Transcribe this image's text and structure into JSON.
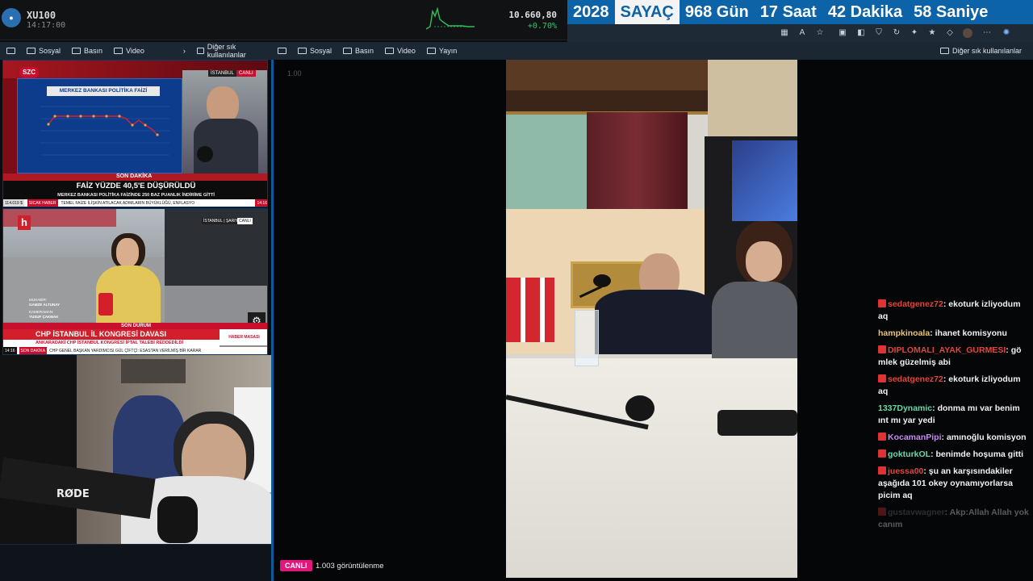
{
  "ticker": {
    "symbol": "XU100",
    "time": "14:17:00",
    "value": "10.660,80",
    "change": "+0.70%"
  },
  "countdown": {
    "year": "2028",
    "label": "SAYAÇ",
    "days": "968 Gün",
    "hours": "17 Saat",
    "minutes": "42 Dakika",
    "seconds": "58 Saniye"
  },
  "bookmarks_left": [
    "Sosyal",
    "Basın",
    "Video"
  ],
  "bookmarks_left_other": "Diğer sık kullanılanlar",
  "bookmarks_right": [
    "Sosyal",
    "Basın",
    "Video",
    "Yayın"
  ],
  "bookmarks_right_other": "Diğer sık kullanılanlar",
  "tv1": {
    "channel": "SZC",
    "chart_title": "MERKEZ BANKASI POLİTİKA FAİZİ",
    "location": "İSTANBUL",
    "live": "CANLI",
    "breaking": "SON DAKİKA",
    "headline": "FAİZ YÜZDE 40,5'E DÜŞÜRÜLDÜ",
    "subline": "MERKEZ BANKASI POLİTİKA FAİZİNDE 250 BAZ PUANLIK İNDİRİME GİTTİ",
    "ticker_a": "114.019 $",
    "ticker_b": "SICAK HABER",
    "ticker_c": "TEMEL FAİZE İLİŞKİN ATILACAK ADIMLARIN BÜYÜKLÜĞÜ, ENFLASYO",
    "ticker_time": "14:16"
  },
  "tv2": {
    "channel": "h",
    "location": "İSTANBUL | ŞARIYER",
    "live": "CANLI",
    "reporter_label": "MUHABİR:",
    "reporter": "GAMZE ALTUNAY",
    "camera_label": "KAMERAMAN:",
    "camera": "YUSUF ÇAKMAK",
    "banner": "SON DURUM",
    "headline": "CHP İSTANBUL İL KONGRESİ DAVASI",
    "subline": "ANKARADAKİ CHP İSTANBUL KONGRESİ İPTAL TALEBİ REDDEDİLDİ",
    "tag": "HABER MASASI",
    "ticker_time": "14:16",
    "ticker_label": "SON DAKİKA",
    "ticker_text": "CHP GENEL BAŞKAN YARDIMCISI GÜL ÇİFTÇİ: ESASTAN VERİLMİŞ BİR KARAR"
  },
  "cam": {
    "mic_brand": "RØDE"
  },
  "player": {
    "speed": "1.00",
    "live": "CANLI",
    "views": "1.003 görüntülenme"
  },
  "chat": [
    {
      "user": "sedatgenez72",
      "color": "#e0463c",
      "text": "ekoturk izliyodum aq",
      "badge": true
    },
    {
      "user": "hampkinoala",
      "color": "#e8c37a",
      "text": "ihanet komisyonu",
      "badge": false
    },
    {
      "user": "DIPLOMALI_AYAK_GURMESI",
      "color": "#e0463c",
      "text": "gö mlek güzelmiş abi",
      "badge": true
    },
    {
      "user": "sedatgenez72",
      "color": "#e0463c",
      "text": "ekoturk izliyodum aq",
      "badge": true
    },
    {
      "user": "1337Dynamic",
      "color": "#68d9a8",
      "text": "donma mı var benim ınt mı yar yedi",
      "badge": false
    },
    {
      "user": "KocamanPipi",
      "color": "#c48cf0",
      "text": "amınoğlu komisyon",
      "badge": true
    },
    {
      "user": "gokturkOL",
      "color": "#68d9a8",
      "text": "benimde hoşuma gitti",
      "badge": true
    },
    {
      "user": "juessa00",
      "color": "#e0463c",
      "text": "şu an karşısındakiler aşağıda 101 okey oynamıyorlarsa picim aq",
      "badge": true
    },
    {
      "user": "gustavwagner",
      "color": "#777777",
      "text": "Akp:Allah Allah yok canım",
      "badge": true
    }
  ]
}
